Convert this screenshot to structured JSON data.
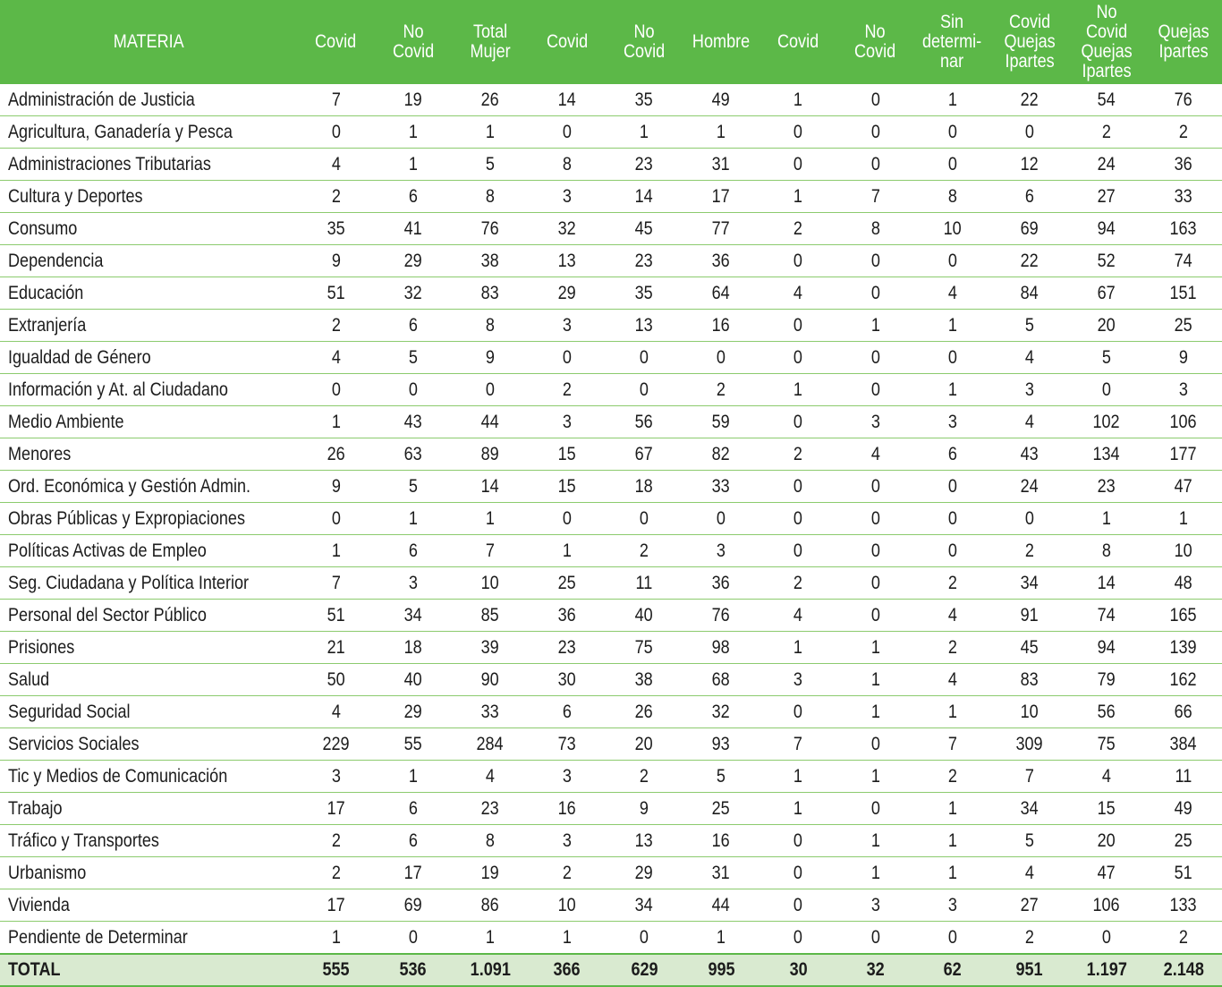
{
  "table": {
    "headers": [
      [
        "MATERIA"
      ],
      [
        "Covid"
      ],
      [
        "No",
        "Covid"
      ],
      [
        "Total",
        "Mujer"
      ],
      [
        "Covid"
      ],
      [
        "No",
        "Covid"
      ],
      [
        "Hombre"
      ],
      [
        "Covid"
      ],
      [
        "No",
        "Covid"
      ],
      [
        "Sin",
        "determi-",
        "nar"
      ],
      [
        "Covid",
        "Quejas",
        "Ipartes"
      ],
      [
        "No Covid",
        "Quejas",
        "Ipartes"
      ],
      [
        "Quejas",
        "Ipartes"
      ]
    ],
    "rows": [
      [
        "Administración de Justicia",
        "7",
        "19",
        "26",
        "14",
        "35",
        "49",
        "1",
        "0",
        "1",
        "22",
        "54",
        "76"
      ],
      [
        "Agricultura, Ganadería y Pesca",
        "0",
        "1",
        "1",
        "0",
        "1",
        "1",
        "0",
        "0",
        "0",
        "0",
        "2",
        "2"
      ],
      [
        "Administraciones Tributarias",
        "4",
        "1",
        "5",
        "8",
        "23",
        "31",
        "0",
        "0",
        "0",
        "12",
        "24",
        "36"
      ],
      [
        "Cultura y Deportes",
        "2",
        "6",
        "8",
        "3",
        "14",
        "17",
        "1",
        "7",
        "8",
        "6",
        "27",
        "33"
      ],
      [
        "Consumo",
        "35",
        "41",
        "76",
        "32",
        "45",
        "77",
        "2",
        "8",
        "10",
        "69",
        "94",
        "163"
      ],
      [
        "Dependencia",
        "9",
        "29",
        "38",
        "13",
        "23",
        "36",
        "0",
        "0",
        "0",
        "22",
        "52",
        "74"
      ],
      [
        "Educación",
        "51",
        "32",
        "83",
        "29",
        "35",
        "64",
        "4",
        "0",
        "4",
        "84",
        "67",
        "151"
      ],
      [
        "Extranjería",
        "2",
        "6",
        "8",
        "3",
        "13",
        "16",
        "0",
        "1",
        "1",
        "5",
        "20",
        "25"
      ],
      [
        "Igualdad de Género",
        "4",
        "5",
        "9",
        "0",
        "0",
        "0",
        "0",
        "0",
        "0",
        "4",
        "5",
        "9"
      ],
      [
        "Información y At. al Ciudadano",
        "0",
        "0",
        "0",
        "2",
        "0",
        "2",
        "1",
        "0",
        "1",
        "3",
        "0",
        "3"
      ],
      [
        "Medio Ambiente",
        "1",
        "43",
        "44",
        "3",
        "56",
        "59",
        "0",
        "3",
        "3",
        "4",
        "102",
        "106"
      ],
      [
        "Menores",
        "26",
        "63",
        "89",
        "15",
        "67",
        "82",
        "2",
        "4",
        "6",
        "43",
        "134",
        "177"
      ],
      [
        "Ord. Económica y Gestión Admin.",
        "9",
        "5",
        "14",
        "15",
        "18",
        "33",
        "0",
        "0",
        "0",
        "24",
        "23",
        "47"
      ],
      [
        "Obras Públicas y Expropiaciones",
        "0",
        "1",
        "1",
        "0",
        "0",
        "0",
        "0",
        "0",
        "0",
        "0",
        "1",
        "1"
      ],
      [
        "Políticas Activas de Empleo",
        "1",
        "6",
        "7",
        "1",
        "2",
        "3",
        "0",
        "0",
        "0",
        "2",
        "8",
        "10"
      ],
      [
        "Seg. Ciudadana y Política Interior",
        "7",
        "3",
        "10",
        "25",
        "11",
        "36",
        "2",
        "0",
        "2",
        "34",
        "14",
        "48"
      ],
      [
        "Personal del Sector Público",
        "51",
        "34",
        "85",
        "36",
        "40",
        "76",
        "4",
        "0",
        "4",
        "91",
        "74",
        "165"
      ],
      [
        "Prisiones",
        "21",
        "18",
        "39",
        "23",
        "75",
        "98",
        "1",
        "1",
        "2",
        "45",
        "94",
        "139"
      ],
      [
        "Salud",
        "50",
        "40",
        "90",
        "30",
        "38",
        "68",
        "3",
        "1",
        "4",
        "83",
        "79",
        "162"
      ],
      [
        "Seguridad Social",
        "4",
        "29",
        "33",
        "6",
        "26",
        "32",
        "0",
        "1",
        "1",
        "10",
        "56",
        "66"
      ],
      [
        "Servicios Sociales",
        "229",
        "55",
        "284",
        "73",
        "20",
        "93",
        "7",
        "0",
        "7",
        "309",
        "75",
        "384"
      ],
      [
        "Tic y Medios de Comunicación",
        "3",
        "1",
        "4",
        "3",
        "2",
        "5",
        "1",
        "1",
        "2",
        "7",
        "4",
        "11"
      ],
      [
        "Trabajo",
        "17",
        "6",
        "23",
        "16",
        "9",
        "25",
        "1",
        "0",
        "1",
        "34",
        "15",
        "49"
      ],
      [
        "Tráfico y Transportes",
        "2",
        "6",
        "8",
        "3",
        "13",
        "16",
        "0",
        "1",
        "1",
        "5",
        "20",
        "25"
      ],
      [
        "Urbanismo",
        "2",
        "17",
        "19",
        "2",
        "29",
        "31",
        "0",
        "1",
        "1",
        "4",
        "47",
        "51"
      ],
      [
        "Vivienda",
        "17",
        "69",
        "86",
        "10",
        "34",
        "44",
        "0",
        "3",
        "3",
        "27",
        "106",
        "133"
      ],
      [
        "Pendiente de Determinar",
        "1",
        "0",
        "1",
        "1",
        "0",
        "1",
        "0",
        "0",
        "0",
        "2",
        "0",
        "2"
      ]
    ],
    "total": [
      "TOTAL",
      "555",
      "536",
      "1.091",
      "366",
      "629",
      "995",
      "30",
      "32",
      "62",
      "951",
      "1.197",
      "2.148"
    ]
  },
  "colors": {
    "header_bg": "#5cb848",
    "header_text": "#ffffff",
    "row_divider": "#8ccb6e",
    "total_bg": "#d9ead0"
  }
}
